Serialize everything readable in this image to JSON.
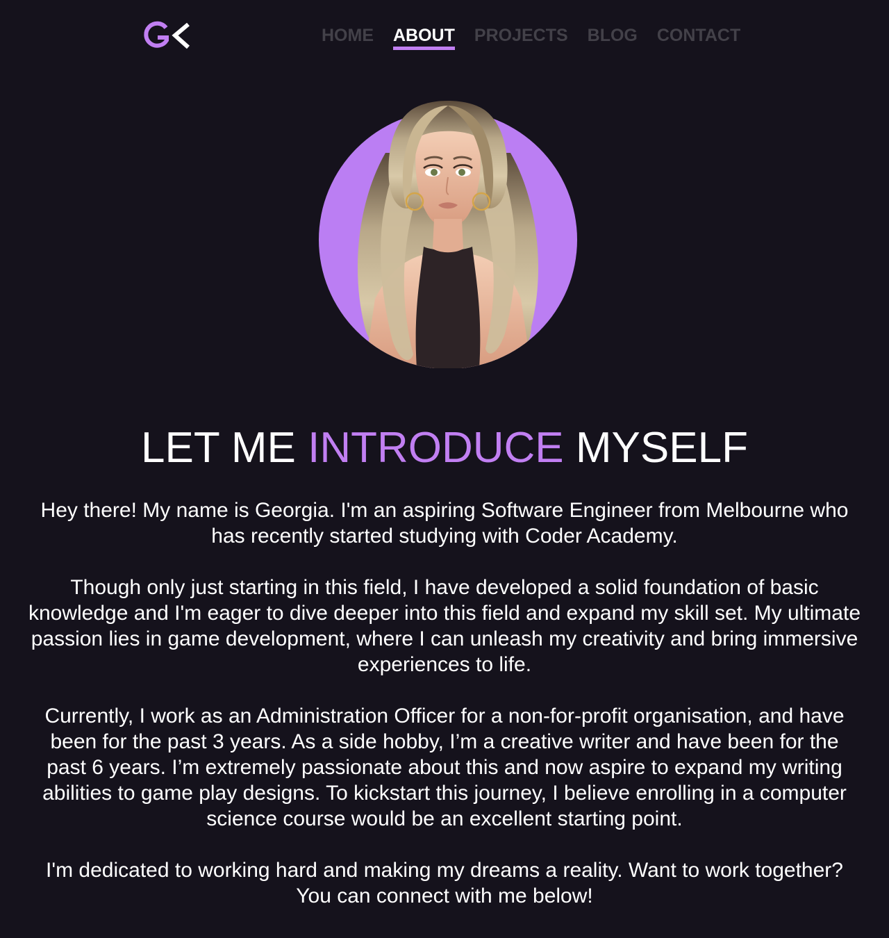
{
  "logo": {
    "text_g": "G",
    "text_k": "K",
    "icon": "gk-monogram-logo",
    "accent_color": "#c17ff2"
  },
  "nav": {
    "items": [
      {
        "label": "HOME",
        "active": false
      },
      {
        "label": "ABOUT",
        "active": true
      },
      {
        "label": "PROJECTS",
        "active": false
      },
      {
        "label": "BLOG",
        "active": false
      },
      {
        "label": "CONTACT",
        "active": false
      }
    ]
  },
  "avatar": {
    "icon": "profile-avatar-illustration",
    "background_color": "#bb7ef3"
  },
  "heading": {
    "part1": "LET ME ",
    "part2": "INTRODUCE",
    "part3": " MYSELF"
  },
  "intro": {
    "paragraphs": [
      "Hey there! My name is Georgia. I'm an aspiring Software Engineer from Melbourne who has recently started studying with Coder Academy.",
      "Though only just starting in this field, I have developed a solid foundation of basic knowledge and I'm eager to dive deeper into this field and expand my skill set. My ultimate passion lies in game development, where I can unleash my creativity and bring immersive experiences to life.",
      "Currently, I work as an Administration Officer for a non-for-profit organisation, and have been for the past 3 years. As a side hobby, I’m a creative writer and have been for the past 6 years. I’m extremely passionate about this and now aspire to expand my writing abilities to game play designs. To kickstart this journey, I believe enrolling in a computer science course would be an excellent starting point.",
      "I'm dedicated to working hard and making my dreams a reality. Want to work together? You can connect with me below!"
    ]
  },
  "colors": {
    "background": "#15121c",
    "accent": "#c17ff2",
    "nav_inactive": "#434149",
    "text": "#ffffff"
  }
}
